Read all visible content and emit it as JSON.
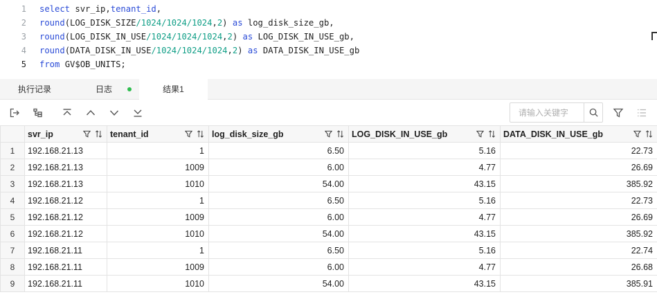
{
  "editor": {
    "lines": [
      {
        "no": "1",
        "tokens": [
          [
            "kw",
            "select"
          ],
          [
            "t",
            " svr_ip,"
          ],
          [
            "fn",
            "tenant_id"
          ],
          [
            "t",
            ","
          ]
        ]
      },
      {
        "no": "2",
        "tokens": [
          [
            "fn",
            "round"
          ],
          [
            "t",
            "(LOG_DISK_SIZE"
          ],
          [
            "nm",
            "/1024/1024/1024"
          ],
          [
            "t",
            ","
          ],
          [
            "nm",
            "2"
          ],
          [
            "t",
            ") "
          ],
          [
            "kw",
            "as"
          ],
          [
            "t",
            " log_disk_size_gb,"
          ]
        ]
      },
      {
        "no": "3",
        "tokens": [
          [
            "fn",
            "round"
          ],
          [
            "t",
            "(LOG_DISK_IN_USE"
          ],
          [
            "nm",
            "/1024/1024/1024"
          ],
          [
            "t",
            ","
          ],
          [
            "nm",
            "2"
          ],
          [
            "t",
            ") "
          ],
          [
            "kw",
            "as"
          ],
          [
            "t",
            " LOG_DISK_IN_USE_gb,"
          ]
        ]
      },
      {
        "no": "4",
        "tokens": [
          [
            "fn",
            "round"
          ],
          [
            "t",
            "(DATA_DISK_IN_USE"
          ],
          [
            "nm",
            "/1024/1024/1024"
          ],
          [
            "t",
            ","
          ],
          [
            "nm",
            "2"
          ],
          [
            "t",
            ") "
          ],
          [
            "kw",
            "as"
          ],
          [
            "t",
            " DATA_DISK_IN_USE_gb"
          ]
        ]
      },
      {
        "no": "5",
        "tokens": [
          [
            "kw",
            "from"
          ],
          [
            "t",
            " GV$OB_UNITS;"
          ]
        ]
      }
    ]
  },
  "tabs": {
    "history": "执行记录",
    "log": "日志",
    "result": "结果1"
  },
  "toolbar": {
    "search_placeholder": "请输入关键字",
    "icons": [
      "export-icon",
      "tree-structure-icon",
      "move-top-icon",
      "move-up-icon",
      "move-down-icon",
      "move-bottom-icon",
      "search-icon",
      "filter-icon",
      "column-list-icon"
    ]
  },
  "colors": {
    "keyword": "#2a4bd7",
    "number": "#0f9e86",
    "status_dot": "#2ebd4e"
  },
  "table": {
    "columns": [
      "svr_ip",
      "tenant_id",
      "log_disk_size_gb",
      "LOG_DISK_IN_USE_gb",
      "DATA_DISK_IN_USE_gb"
    ],
    "rows": [
      [
        "1",
        "192.168.21.13",
        "1",
        "6.50",
        "5.16",
        "22.73"
      ],
      [
        "2",
        "192.168.21.13",
        "1009",
        "6.00",
        "4.77",
        "26.69"
      ],
      [
        "3",
        "192.168.21.13",
        "1010",
        "54.00",
        "43.15",
        "385.92"
      ],
      [
        "4",
        "192.168.21.12",
        "1",
        "6.50",
        "5.16",
        "22.73"
      ],
      [
        "5",
        "192.168.21.12",
        "1009",
        "6.00",
        "4.77",
        "26.69"
      ],
      [
        "6",
        "192.168.21.12",
        "1010",
        "54.00",
        "43.15",
        "385.92"
      ],
      [
        "7",
        "192.168.21.11",
        "1",
        "6.50",
        "5.16",
        "22.74"
      ],
      [
        "8",
        "192.168.21.11",
        "1009",
        "6.00",
        "4.77",
        "26.68"
      ],
      [
        "9",
        "192.168.21.11",
        "1010",
        "54.00",
        "43.15",
        "385.91"
      ]
    ]
  }
}
